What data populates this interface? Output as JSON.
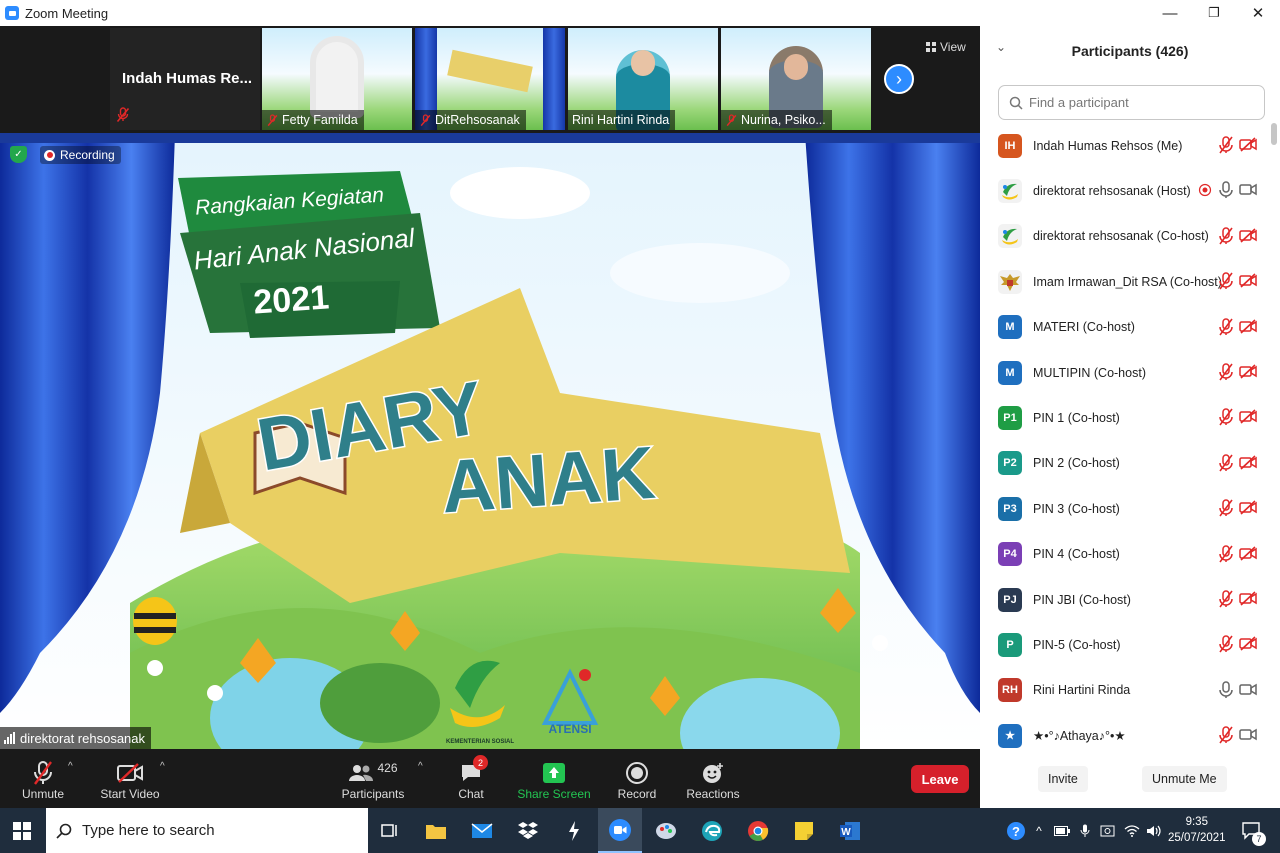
{
  "window": {
    "title": "Zoom Meeting",
    "minimize_glyph": "—",
    "maximize_glyph": "❐",
    "close_glyph": "✕"
  },
  "self_tile": {
    "name": "Indah Humas Re..."
  },
  "video_tiles": [
    {
      "name": "Fetty Familda",
      "muted": true
    },
    {
      "name": "DitRehsosanak",
      "muted": true
    },
    {
      "name": "Rini Hartini Rinda",
      "muted": false
    },
    {
      "name": "Nurina, Psiko...",
      "muted": true
    }
  ],
  "view_button": "View",
  "next_glyph": "›",
  "recording_label": "Recording",
  "active_speaker": "direktorat rehsosanak",
  "shared_content": {
    "banner_line1": "Rangkaian Kegiatan",
    "banner_line2": "Hari Anak Nasional",
    "banner_year": "2021",
    "title_1": "DIARY",
    "title_2": "ANAK",
    "logo_1_text": "KEMENTERIAN SOSIAL",
    "logo_2_text": "ATENSI"
  },
  "toolbar": {
    "unmute": "Unmute",
    "start_video": "Start Video",
    "participants": "Participants",
    "participants_count": "426",
    "chat": "Chat",
    "chat_badge": "2",
    "share_screen": "Share Screen",
    "record": "Record",
    "reactions": "Reactions",
    "leave": "Leave",
    "caret": "^"
  },
  "panel": {
    "title": "Participants (426)",
    "search_placeholder": "Find a participant",
    "invite": "Invite",
    "unmute_me": "Unmute Me"
  },
  "participants": [
    {
      "initials": "IH",
      "color": "#d6561f",
      "name": "Indah Humas Rehsos (Me)",
      "mic": "muted",
      "video": "off"
    },
    {
      "initials": "",
      "color": "#ffffff",
      "avatar_icon": "kemensos-logo-icon",
      "name": "direktorat rehsosanak (Host)",
      "mic": "on",
      "video": "on",
      "recording": true
    },
    {
      "initials": "",
      "color": "#ffffff",
      "avatar_icon": "kemensos-logo-icon",
      "name": "direktorat rehsosanak (Co-host)",
      "mic": "muted",
      "video": "off"
    },
    {
      "initials": "",
      "color": "#ffffff",
      "avatar_icon": "garuda-icon",
      "name": "Imam Irmawan_Dit RSA (Co-host)",
      "mic": "muted",
      "video": "off"
    },
    {
      "initials": "M",
      "color": "#1f6fbf",
      "name": "MATERI (Co-host)",
      "mic": "muted",
      "video": "off"
    },
    {
      "initials": "M",
      "color": "#1f6fbf",
      "name": "MULTIPIN (Co-host)",
      "mic": "muted",
      "video": "off"
    },
    {
      "initials": "P1",
      "color": "#1f9d45",
      "name": "PIN 1 (Co-host)",
      "mic": "muted",
      "video": "off"
    },
    {
      "initials": "P2",
      "color": "#1a9a8a",
      "name": "PIN 2 (Co-host)",
      "mic": "muted",
      "video": "off"
    },
    {
      "initials": "P3",
      "color": "#1a6fa8",
      "name": "PIN 3 (Co-host)",
      "mic": "muted",
      "video": "off"
    },
    {
      "initials": "P4",
      "color": "#7b3fb5",
      "name": "PIN 4 (Co-host)",
      "mic": "muted",
      "video": "off"
    },
    {
      "initials": "PJ",
      "color": "#2a3a52",
      "name": "PIN JBI (Co-host)",
      "mic": "muted",
      "video": "off"
    },
    {
      "initials": "P",
      "color": "#1a9a7a",
      "name": "PIN-5 (Co-host)",
      "mic": "muted",
      "video": "off"
    },
    {
      "initials": "RH",
      "color": "#c0392b",
      "name": "Rini Hartini Rinda",
      "mic": "on",
      "video": "on"
    },
    {
      "initials": "★",
      "color": "#1f6fbf",
      "name": "★•°♪Athaya♪°•★",
      "mic": "muted",
      "video": "on"
    }
  ],
  "taskbar": {
    "search_placeholder": "Type here to search",
    "time": "9:35",
    "date": "25/07/2021",
    "notification_count": "7"
  },
  "colors": {
    "accent": "#2d8cff",
    "leave": "#d6202b",
    "muted_icon": "#e02828",
    "share": "#23c552"
  }
}
